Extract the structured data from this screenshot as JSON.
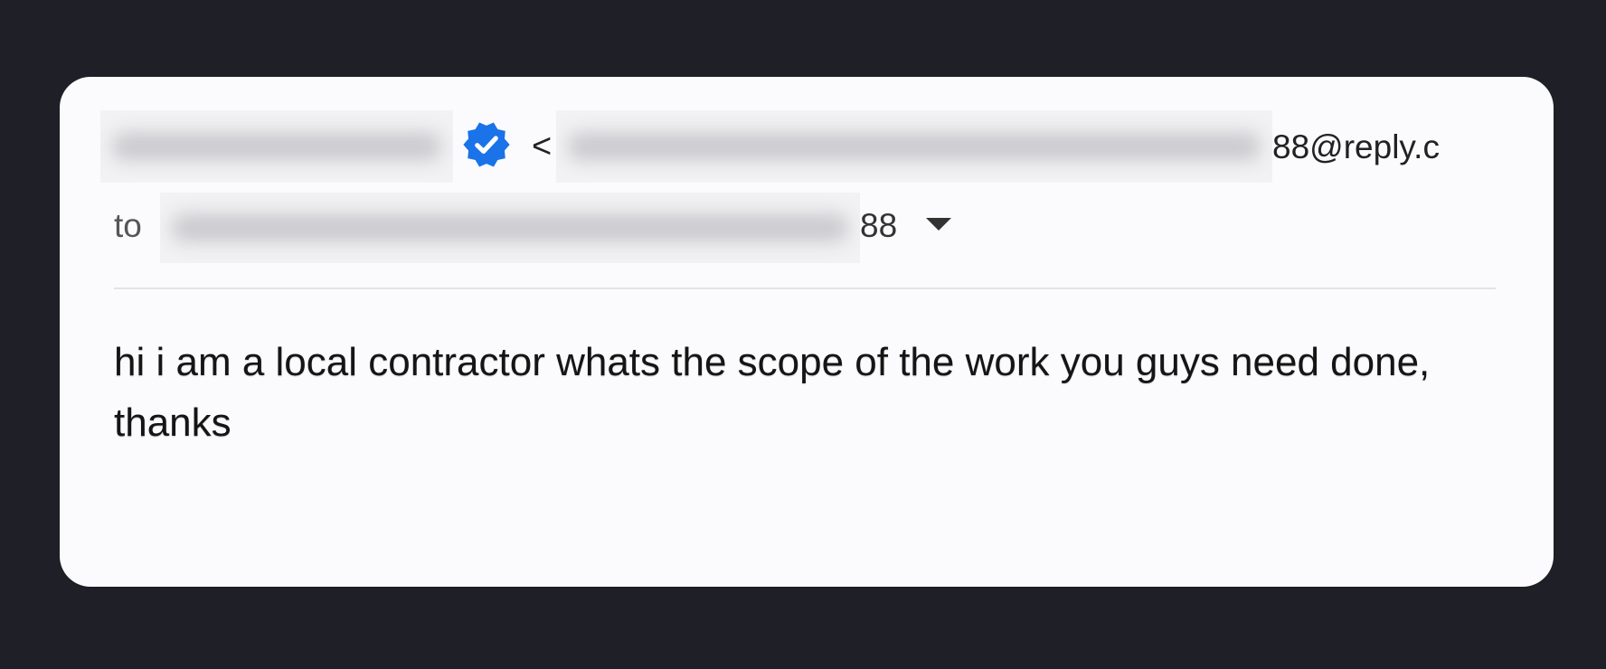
{
  "header": {
    "verified_icon": "verified-badge-icon",
    "email_open_bracket": "<",
    "sender_email_visible_tail": "88@reply.c",
    "to_label": "to",
    "recipient_visible_tail": "88",
    "dropdown_icon": "caret-down-icon"
  },
  "colors": {
    "background": "#1f2027",
    "card": "#fbfbfd",
    "verified_badge": "#1a73e8"
  },
  "message": {
    "body": "hi i am a local contractor whats the scope of the work you guys need done, thanks"
  }
}
